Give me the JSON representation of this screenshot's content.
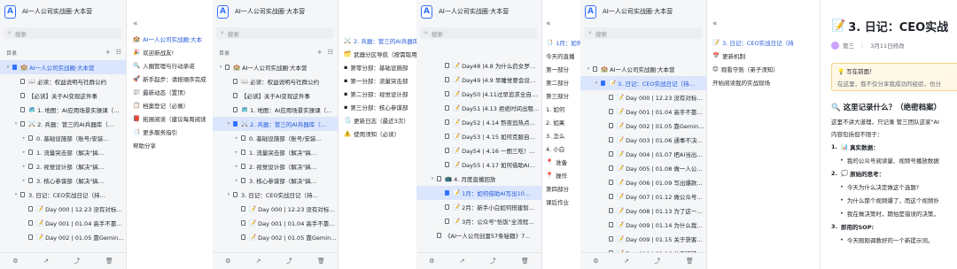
{
  "app": {
    "logo_letter": "A",
    "window_title": "AI一人公司实战圈·大本营",
    "search_placeholder": "搜索",
    "toc_label": "目录",
    "add_icon": "+",
    "menu_icon": "☷",
    "collapse_icon": "«",
    "footer_icons": [
      "gear-icon",
      "share-icon",
      "chart-icon",
      "trash-icon"
    ]
  },
  "frame1": {
    "tree": [
      {
        "label": "AI一人公司实战圈·大本营",
        "level": 0,
        "caret": "▾",
        "emoji": "🏫",
        "selected": true
      },
      {
        "label": "必读：权益说明与社群公约",
        "level": 1,
        "caret": "",
        "emoji": "📖"
      },
      {
        "label": "【必读】关于AI变现这件事",
        "level": 1,
        "caret": "",
        "emoji": ""
      },
      {
        "label": "1. 地图：AI应用场景实操课（…",
        "level": 1,
        "caret": "",
        "emoji": "🗺️"
      },
      {
        "label": "2. 兵器：管三的AI兵器库（…",
        "level": 1,
        "caret": "▾",
        "emoji": "⚔️"
      },
      {
        "label": "0. 基础设施部（账号/安装…",
        "level": 2,
        "caret": "▸",
        "emoji": ""
      },
      {
        "label": "1. 流量突击部（解决\"搞…",
        "level": 2,
        "caret": "▸",
        "emoji": ""
      },
      {
        "label": "2. 视觉设计部（解决\"搞…",
        "level": 2,
        "caret": "▸",
        "emoji": ""
      },
      {
        "label": "3. 核心参谋部（解决\"搞…",
        "level": 2,
        "caret": "▸",
        "emoji": ""
      },
      {
        "label": "3. 日记：CEO实战日记（持…",
        "level": 1,
        "caret": "▾",
        "emoji": ""
      },
      {
        "label": "Day 000 | 12.23 没有对标…",
        "level": 2,
        "caret": "",
        "emoji": "📝"
      },
      {
        "label": "Day 001 | 01.04 高手不靠…",
        "level": 2,
        "caret": "",
        "emoji": "📝"
      },
      {
        "label": "Day 002 | 01.05 靠Gemin…",
        "level": 2,
        "caret": "",
        "emoji": "📝"
      }
    ],
    "preview": [
      {
        "text": "AI一人公司实战圈·大本",
        "emoji": "🏫",
        "style": "link"
      },
      {
        "text": "欢迎新战友!",
        "emoji": "🎉",
        "style": ""
      },
      {
        "text": "入圈管理与行动承诺",
        "emoji": "🔍",
        "style": ""
      },
      {
        "text": "新手起步：请按顺序完成",
        "emoji": "🚀",
        "style": ""
      },
      {
        "text": "最新动态（置顶）",
        "emoji": "📰",
        "style": ""
      },
      {
        "text": "档案登记（必做）",
        "emoji": "📋",
        "style": ""
      },
      {
        "text": "拓展阅读（建议每周阅读",
        "emoji": "📕",
        "style": ""
      },
      {
        "text": "更多服务指引",
        "emoji": "📑",
        "style": ""
      },
      {
        "text": "帮助分享",
        "emoji": "",
        "style": ""
      }
    ]
  },
  "frame2": {
    "tree": [
      {
        "label": "AI一人公司实战圈·大本营",
        "level": 0,
        "caret": "▾",
        "emoji": "🏫"
      },
      {
        "label": "必读：权益说明与社群公约",
        "level": 1,
        "caret": "",
        "emoji": "📖"
      },
      {
        "label": "【必读】关于AI变现这件事",
        "level": 1,
        "caret": "",
        "emoji": ""
      },
      {
        "label": "1. 地图：AI应用场景实操课（…",
        "level": 1,
        "caret": "",
        "emoji": "🗺️"
      },
      {
        "label": "2. 兵器：管三的AI兵器库（…",
        "level": 1,
        "caret": "▾",
        "emoji": "⚔️",
        "selected": true
      },
      {
        "label": "0. 基础设施部（账号/安装…",
        "level": 2,
        "caret": "▸",
        "emoji": ""
      },
      {
        "label": "1. 流量突击部（解决\"搞…",
        "level": 2,
        "caret": "▸",
        "emoji": ""
      },
      {
        "label": "2. 视觉设计部（解决\"搞…",
        "level": 2,
        "caret": "▸",
        "emoji": ""
      },
      {
        "label": "3. 核心参谋部（解决\"搞…",
        "level": 2,
        "caret": "▸",
        "emoji": ""
      },
      {
        "label": "3. 日记：CEO实战日记（持…",
        "level": 1,
        "caret": "▾",
        "emoji": ""
      },
      {
        "label": "Day 000 | 12.23 没有对标…",
        "level": 2,
        "caret": "",
        "emoji": "📝"
      },
      {
        "label": "Day 001 | 01.04 高手不靠…",
        "level": 2,
        "caret": "",
        "emoji": "📝"
      },
      {
        "label": "Day 002 | 01.05 靠Gemin…",
        "level": 2,
        "caret": "",
        "emoji": "📝"
      }
    ],
    "preview": [
      {
        "text": "2. 兵器：管三的AI兵器库",
        "emoji": "⚔️",
        "style": "link"
      },
      {
        "text": "武器分区导航（按需取用",
        "emoji": "🗂️",
        "style": ""
      },
      {
        "text": "第零分部：基础设施部",
        "emoji": "▪",
        "style": ""
      },
      {
        "text": "第一分部：流量突击部",
        "emoji": "▪",
        "style": ""
      },
      {
        "text": "第二分部：视觉设计部",
        "emoji": "▪",
        "style": ""
      },
      {
        "text": "第三分部：核心参谋部",
        "emoji": "▪",
        "style": ""
      },
      {
        "text": "更新日志（最近3次）",
        "emoji": "🗒️",
        "style": ""
      },
      {
        "text": "使用须知（必读）",
        "emoji": "⚠️",
        "style": ""
      }
    ]
  },
  "frame3": {
    "tree": [
      {
        "label": "Day48 |4.8 为什么药女罗…",
        "level": 2,
        "caret": "",
        "emoji": "📝"
      },
      {
        "label": "Day49 |4.9 早睡觉要会设…",
        "level": 2,
        "caret": "",
        "emoji": "📝"
      },
      {
        "label": "Day50 |4.11过早追求全自…",
        "level": 2,
        "caret": "",
        "emoji": "📝"
      },
      {
        "label": "Day51 |4.13 拒绝时间出租…",
        "level": 2,
        "caret": "",
        "emoji": "📝"
      },
      {
        "label": "Day52 | 4.14 熬夜追热点…",
        "level": 2,
        "caret": "",
        "emoji": "📝"
      },
      {
        "label": "Day53 | 4.15 如何克服自…",
        "level": 2,
        "caret": "",
        "emoji": "📝"
      },
      {
        "label": "Day54 | 4.16 一图三吃！…",
        "level": 2,
        "caret": "",
        "emoji": "📝"
      },
      {
        "label": "Day55 | 4.17 如何借助AI…",
        "level": 2,
        "caret": "",
        "emoji": "📝"
      },
      {
        "label": "4. 月度直播回放",
        "level": 1,
        "caret": "▾",
        "emoji": "📺"
      },
      {
        "label": "1月：如何借助AI写出10…",
        "level": 2,
        "caret": "",
        "emoji": "📝",
        "selected": true
      },
      {
        "label": "2月：新手小白如何搭建智…",
        "level": 2,
        "caret": "",
        "emoji": "📝"
      },
      {
        "label": "3月：公众号\"恰饭\"全流程…",
        "level": 2,
        "caret": "",
        "emoji": "📝"
      },
      {
        "label": "《AI一人公司创富57条秘籍》7…",
        "level": 1,
        "caret": "",
        "emoji": ""
      }
    ],
    "preview": [
      {
        "text": "1月：如何",
        "emoji": "📑",
        "style": "link"
      },
      {
        "text": "今天的直播",
        "emoji": "",
        "style": ""
      },
      {
        "text": "第一部分",
        "emoji": "",
        "style": ""
      },
      {
        "text": "第二部分",
        "emoji": "",
        "style": ""
      },
      {
        "text": "第三部分",
        "emoji": "",
        "style": ""
      },
      {
        "text": "1. 如何",
        "emoji": "",
        "style": ""
      },
      {
        "text": "2. 如果",
        "emoji": "",
        "style": ""
      },
      {
        "text": "3. 怎么",
        "emoji": "",
        "style": ""
      },
      {
        "text": "4. 小白",
        "emoji": "",
        "style": ""
      },
      {
        "text": "准备",
        "emoji": "📍",
        "style": ""
      },
      {
        "text": "操作",
        "emoji": "📍",
        "style": ""
      },
      {
        "text": "第四部分",
        "emoji": "",
        "style": ""
      },
      {
        "text": "课后作业",
        "emoji": "",
        "style": ""
      }
    ]
  },
  "frame4": {
    "tree": [
      {
        "label": "AI一人公司实战圈·大本营",
        "level": 0,
        "caret": "▾",
        "emoji": "🏫"
      },
      {
        "label": "3. 日记：CEO实战日记（持…",
        "level": 1,
        "caret": "▾",
        "emoji": "📝",
        "selected": true
      },
      {
        "label": "Day 000 | 12.23 没有对标…",
        "level": 2,
        "caret": "",
        "emoji": "📝"
      },
      {
        "label": "Day 001 | 01.04 高手不靠…",
        "level": 2,
        "caret": "",
        "emoji": "📝"
      },
      {
        "label": "Day 002 | 01.05 靠Gemin…",
        "level": 2,
        "caret": "",
        "emoji": "📝"
      },
      {
        "label": "Day 003 | 01.06 通事不决…",
        "level": 2,
        "caret": "",
        "emoji": "📝"
      },
      {
        "label": "Day 004 | 01.07 把AI当出…",
        "level": 2,
        "caret": "",
        "emoji": "📝"
      },
      {
        "label": "Day 005 | 01.08 做一人公…",
        "level": 2,
        "caret": "",
        "emoji": "📝"
      },
      {
        "label": "Day 006 | 01.09 写出爆款…",
        "level": 2,
        "caret": "",
        "emoji": "📝"
      },
      {
        "label": "Day 007 | 01.12 做公众号…",
        "level": 2,
        "caret": "",
        "emoji": "📝"
      },
      {
        "label": "Day 008 | 01.13 为了这一…",
        "level": 2,
        "caret": "",
        "emoji": "📝"
      },
      {
        "label": "Day 009 | 01.14 为什么我…",
        "level": 2,
        "caret": "",
        "emoji": "📝"
      },
      {
        "label": "Day 009 | 01.15 关于获客…",
        "level": 2,
        "caret": "",
        "emoji": "📝"
      },
      {
        "label": "Day 010 | 01.16 关于稀缺…",
        "level": 2,
        "caret": "",
        "emoji": "📝"
      }
    ],
    "preview": [
      {
        "text": "3. 日记：CEO实战日记（持",
        "emoji": "📝",
        "style": "link"
      },
      {
        "text": "更新机制",
        "emoji": "📅",
        "style": ""
      },
      {
        "text": "观看守则（弟子须知）",
        "emoji": "😊",
        "style": ""
      },
      {
        "text": "开始阅读我的实战现场",
        "emoji": "",
        "style": ""
      }
    ]
  },
  "frame5": {
    "title": "3. 日记：CEO实战",
    "title_emoji": "📝",
    "author": "管三",
    "modified": "3月11日修改",
    "tip_title": "写在前面！",
    "tip_body": "在这里，我不仅分享我成功的经验，也分",
    "section_title": "这里记录什么？（绝密档案）",
    "section_emoji": "🔍",
    "intro": "这里不讲大道理，只记录 管三团队这家\"AI",
    "intro2": "内容包括但不限于：",
    "items": [
      {
        "n": "1.",
        "emoji": "📊",
        "text": "真实数据：",
        "bold": true
      },
      {
        "n": "•",
        "emoji": "",
        "text": "我的公众号阅读量、视频号播放数据",
        "bold": false
      },
      {
        "n": "2.",
        "emoji": "💭",
        "text": "原始的思考：",
        "bold": true
      },
      {
        "n": "•",
        "emoji": "",
        "text": "今天为什么决定做这个选题?",
        "bold": false
      },
      {
        "n": "•",
        "emoji": "",
        "text": "为什么那个视频爆了，而这个视频扑",
        "bold": false
      },
      {
        "n": "•",
        "emoji": "",
        "text": "我在做决策时，期怕是错误的决策，",
        "bold": false
      },
      {
        "n": "3.",
        "emoji": "",
        "text": "即用的SOP:",
        "bold": true
      },
      {
        "n": "•",
        "emoji": "",
        "text": "今天刚刚调教好的一个新提示词。",
        "bold": false
      }
    ]
  }
}
